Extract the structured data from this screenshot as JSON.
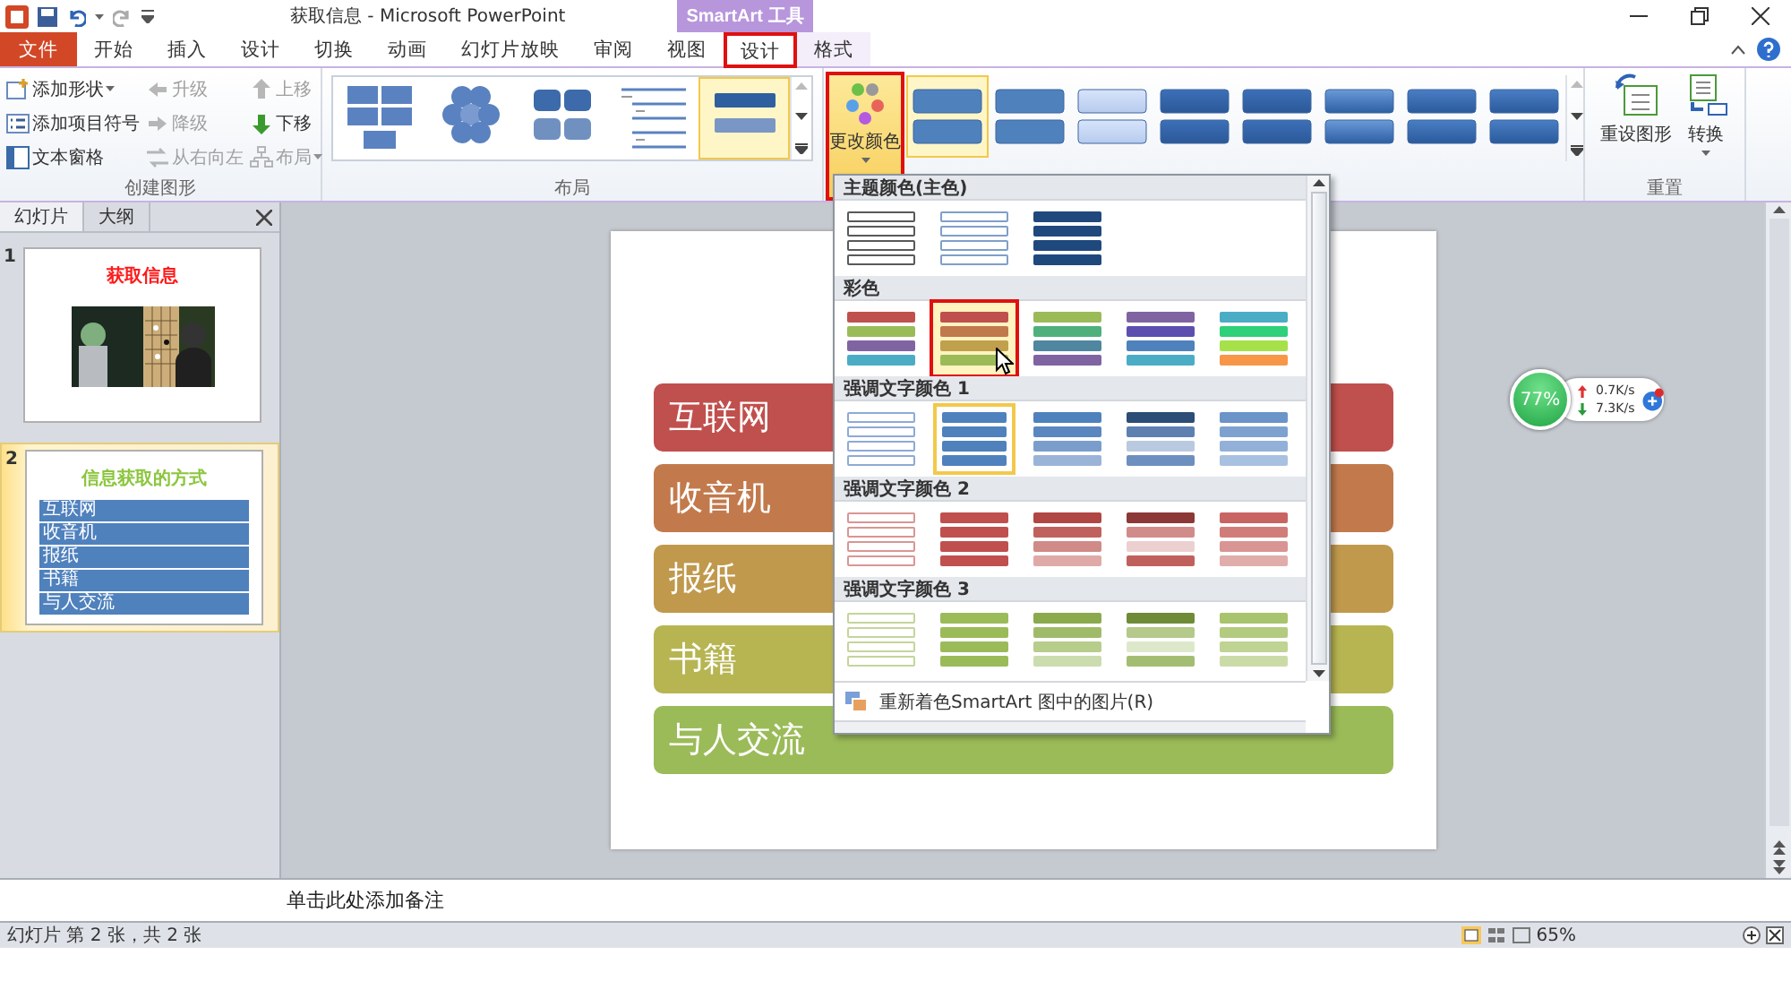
{
  "title_bar": {
    "title": "获取信息 - Microsoft PowerPoint",
    "contextual_label": "SmartArt 工具"
  },
  "tabs": [
    {
      "label": "文件",
      "kind": "file",
      "selected": false,
      "annotated": false
    },
    {
      "label": "开始",
      "kind": "normal",
      "selected": false,
      "annotated": false
    },
    {
      "label": "插入",
      "kind": "normal",
      "selected": false,
      "annotated": false
    },
    {
      "label": "设计",
      "kind": "normal",
      "selected": false,
      "annotated": false
    },
    {
      "label": "切换",
      "kind": "normal",
      "selected": false,
      "annotated": false
    },
    {
      "label": "动画",
      "kind": "normal",
      "selected": false,
      "annotated": false
    },
    {
      "label": "幻灯片放映",
      "kind": "normal",
      "selected": false,
      "annotated": false
    },
    {
      "label": "审阅",
      "kind": "normal",
      "selected": false,
      "annotated": false
    },
    {
      "label": "视图",
      "kind": "normal",
      "selected": false,
      "annotated": false
    },
    {
      "label": "设计",
      "kind": "contextual",
      "selected": true,
      "annotated": true
    },
    {
      "label": "格式",
      "kind": "contextual",
      "selected": false,
      "annotated": false
    }
  ],
  "create_group": {
    "label": "创建图形",
    "columns": [
      [
        {
          "label": "添加形状",
          "kind": "add_shape",
          "disabled": false,
          "dropdown": true
        },
        {
          "label": "添加项目符号",
          "kind": "add_bullet",
          "disabled": false,
          "dropdown": false
        },
        {
          "label": "文本窗格",
          "kind": "text_pane",
          "disabled": false,
          "dropdown": false
        }
      ],
      [
        {
          "label": "升级",
          "kind": "promote",
          "disabled": true,
          "dropdown": false
        },
        {
          "label": "降级",
          "kind": "demote",
          "disabled": true,
          "dropdown": false
        },
        {
          "label": "从右向左",
          "kind": "rtl",
          "disabled": true,
          "dropdown": false
        }
      ],
      [
        {
          "label": "上移",
          "kind": "move_up",
          "disabled": true,
          "dropdown": false
        },
        {
          "label": "下移",
          "kind": "move_down",
          "disabled": false,
          "dropdown": false
        },
        {
          "label": "布局",
          "kind": "layout",
          "disabled": true,
          "dropdown": true
        }
      ]
    ]
  },
  "layout_group": {
    "label": "布局",
    "layouts": [
      {
        "kind": "grid",
        "selected": false
      },
      {
        "kind": "hexagon",
        "selected": false
      },
      {
        "kind": "rounded",
        "selected": false
      },
      {
        "kind": "lines",
        "selected": false
      },
      {
        "kind": "bars",
        "selected": true
      }
    ]
  },
  "style_group": {
    "color_button": {
      "label": "更改颜色",
      "pressed": true,
      "annotated": true
    },
    "styles": [
      {
        "kind": "flat",
        "selected": true
      },
      {
        "kind": "flat",
        "selected": false
      },
      {
        "kind": "light",
        "selected": false
      },
      {
        "kind": "intense",
        "selected": false
      },
      {
        "kind": "intense",
        "selected": false
      },
      {
        "kind": "polished",
        "selected": false
      },
      {
        "kind": "inset",
        "selected": false
      },
      {
        "kind": "inset",
        "selected": false
      }
    ]
  },
  "reset_group": {
    "label": "重置",
    "buttons": [
      {
        "label": "重设图形",
        "kind": "reset",
        "dropdown": false
      },
      {
        "label": "转换",
        "kind": "convert",
        "dropdown": true
      }
    ]
  },
  "slides_panel": {
    "tabs": [
      {
        "label": "幻灯片",
        "selected": true
      },
      {
        "label": "大纲",
        "selected": false
      }
    ],
    "slides": [
      {
        "number": "1",
        "kind": "title_picture",
        "title": "获取信息",
        "selected": false
      },
      {
        "number": "2",
        "kind": "title_list",
        "title": "信息获取的方式",
        "selected": true,
        "items": [
          "互联网",
          "收音机",
          "报纸",
          "书籍",
          "与人交流"
        ]
      }
    ]
  },
  "slide": {
    "items": [
      {
        "text": "互联网",
        "color": "#c0504d"
      },
      {
        "text": "收音机",
        "color": "#c27a4c"
      },
      {
        "text": "报纸",
        "color": "#c0994d"
      },
      {
        "text": "书籍",
        "color": "#b7b552"
      },
      {
        "text": "与人交流",
        "color": "#9bbb59"
      }
    ]
  },
  "color_menu": {
    "sections": [
      {
        "title": "主题颜色(主色)",
        "options": [
          {
            "kind": "outline",
            "bars": [
              {
                "color": "#595959"
              },
              {
                "color": "#595959"
              },
              {
                "color": "#595959"
              },
              {
                "color": "#595959"
              }
            ],
            "selected": false,
            "hovered": false,
            "annotated": false
          },
          {
            "kind": "outline",
            "bars": [
              {
                "color": "#7f9fc9"
              },
              {
                "color": "#7f9fc9"
              },
              {
                "color": "#7f9fc9"
              },
              {
                "color": "#7f9fc9"
              }
            ],
            "selected": false,
            "hovered": false,
            "annotated": false
          },
          {
            "kind": "fill",
            "bars": [
              {
                "color": "#1f497d"
              },
              {
                "color": "#1f497d"
              },
              {
                "color": "#1f497d"
              },
              {
                "color": "#1f497d"
              }
            ],
            "selected": false,
            "hovered": false,
            "annotated": false
          }
        ]
      },
      {
        "title": "彩色",
        "options": [
          {
            "kind": "fill",
            "bars": [
              {
                "color": "#c0504d"
              },
              {
                "color": "#9bbb59"
              },
              {
                "color": "#8064a2"
              },
              {
                "color": "#4bacc6"
              }
            ],
            "selected": false,
            "hovered": false,
            "annotated": false
          },
          {
            "kind": "fill",
            "bars": [
              {
                "color": "#c0504d"
              },
              {
                "color": "#c0784d"
              },
              {
                "color": "#c0a04d"
              },
              {
                "color": "#9bbb59"
              }
            ],
            "selected": false,
            "hovered": true,
            "annotated": true
          },
          {
            "kind": "fill",
            "bars": [
              {
                "color": "#9bbb59"
              },
              {
                "color": "#4fb07c"
              },
              {
                "color": "#4f86a0"
              },
              {
                "color": "#8064a2"
              }
            ],
            "selected": false,
            "hovered": false,
            "annotated": false
          },
          {
            "kind": "fill",
            "bars": [
              {
                "color": "#8064a2"
              },
              {
                "color": "#5c4fb0"
              },
              {
                "color": "#4f81bd"
              },
              {
                "color": "#4bacc6"
              }
            ],
            "selected": false,
            "hovered": false,
            "annotated": false
          },
          {
            "kind": "fill",
            "bars": [
              {
                "color": "#4bacc6"
              },
              {
                "color": "#2fd07a"
              },
              {
                "color": "#a6e14a"
              },
              {
                "color": "#f79646"
              }
            ],
            "selected": false,
            "hovered": false,
            "annotated": false
          }
        ]
      },
      {
        "title": "强调文字颜色 1",
        "options": [
          {
            "kind": "outline",
            "bars": [
              {
                "color": "#8eaad6"
              },
              {
                "color": "#8eaad6"
              },
              {
                "color": "#8eaad6"
              },
              {
                "color": "#8eaad6"
              }
            ],
            "selected": false,
            "hovered": false,
            "annotated": false
          },
          {
            "kind": "fill",
            "bars": [
              {
                "color": "#4f81bd"
              },
              {
                "color": "#4f81bd"
              },
              {
                "color": "#4f81bd"
              },
              {
                "color": "#4f81bd"
              }
            ],
            "selected": true,
            "hovered": false,
            "annotated": false
          },
          {
            "kind": "fill",
            "bars": [
              {
                "color": "#4f81bd"
              },
              {
                "color": "#5b87c0"
              },
              {
                "color": "#7a9dcc"
              },
              {
                "color": "#9ab4d8"
              }
            ],
            "selected": false,
            "hovered": false,
            "annotated": false
          },
          {
            "kind": "fill",
            "bars": [
              {
                "color": "#2c4d75"
              },
              {
                "color": "#5e80b0"
              },
              {
                "color": "#b9c9e0"
              },
              {
                "color": "#6d8fc0"
              }
            ],
            "selected": false,
            "hovered": false,
            "annotated": false
          },
          {
            "kind": "fill",
            "bars": [
              {
                "color": "#6b94c8"
              },
              {
                "color": "#7ea2d0"
              },
              {
                "color": "#93b1d8"
              },
              {
                "color": "#a9c1e0"
              }
            ],
            "selected": false,
            "hovered": false,
            "annotated": false
          }
        ]
      },
      {
        "title": "强调文字颜色 2",
        "options": [
          {
            "kind": "outline",
            "bars": [
              {
                "color": "#d99694"
              },
              {
                "color": "#d99694"
              },
              {
                "color": "#d99694"
              },
              {
                "color": "#d99694"
              }
            ],
            "selected": false,
            "hovered": false,
            "annotated": false
          },
          {
            "kind": "fill",
            "bars": [
              {
                "color": "#c0504d"
              },
              {
                "color": "#c0504d"
              },
              {
                "color": "#c0504d"
              },
              {
                "color": "#c0504d"
              }
            ],
            "selected": false,
            "hovered": false,
            "annotated": false
          },
          {
            "kind": "fill",
            "bars": [
              {
                "color": "#b14744"
              },
              {
                "color": "#c0615e"
              },
              {
                "color": "#d08a88"
              },
              {
                "color": "#dfa9a7"
              }
            ],
            "selected": false,
            "hovered": false,
            "annotated": false
          },
          {
            "kind": "fill",
            "bars": [
              {
                "color": "#8c3836"
              },
              {
                "color": "#d18c8a"
              },
              {
                "color": "#ecd0cf"
              },
              {
                "color": "#c0605d"
              }
            ],
            "selected": false,
            "hovered": false,
            "annotated": false
          },
          {
            "kind": "fill",
            "bars": [
              {
                "color": "#c86562"
              },
              {
                "color": "#d07d7a"
              },
              {
                "color": "#d89593"
              },
              {
                "color": "#e0adab"
              }
            ],
            "selected": false,
            "hovered": false,
            "annotated": false
          }
        ]
      },
      {
        "title": "强调文字颜色 3",
        "options": [
          {
            "kind": "outline",
            "bars": [
              {
                "color": "#c3d69b"
              },
              {
                "color": "#c3d69b"
              },
              {
                "color": "#c3d69b"
              },
              {
                "color": "#c3d69b"
              }
            ],
            "selected": false,
            "hovered": false,
            "annotated": false
          },
          {
            "kind": "fill",
            "bars": [
              {
                "color": "#9bbb59"
              },
              {
                "color": "#9bbb59"
              },
              {
                "color": "#9bbb59"
              },
              {
                "color": "#9bbb59"
              }
            ],
            "selected": false,
            "hovered": false,
            "annotated": false
          },
          {
            "kind": "fill",
            "bars": [
              {
                "color": "#8aaa4d"
              },
              {
                "color": "#9fbb6a"
              },
              {
                "color": "#b6cd8c"
              },
              {
                "color": "#cbdcaf"
              }
            ],
            "selected": false,
            "hovered": false,
            "annotated": false
          },
          {
            "kind": "fill",
            "bars": [
              {
                "color": "#6f8b38"
              },
              {
                "color": "#b4c98a"
              },
              {
                "color": "#dde8ca"
              },
              {
                "color": "#a3be72"
              }
            ],
            "selected": false,
            "hovered": false,
            "annotated": false
          },
          {
            "kind": "fill",
            "bars": [
              {
                "color": "#a8c46c"
              },
              {
                "color": "#b3cb7e"
              },
              {
                "color": "#bfd393"
              },
              {
                "color": "#cbdba8"
              }
            ],
            "selected": false,
            "hovered": false,
            "annotated": false
          }
        ]
      }
    ],
    "footer": "重新着色SmartArt 图中的图片(R)"
  },
  "network_widget": {
    "percent": "77%",
    "upload": "0.7K/s",
    "download": "7.3K/s"
  },
  "notes": {
    "placeholder": "单击此处添加备注"
  },
  "status_bar": {
    "slide_info": "幻灯片 第 2 张，共 2 张",
    "zoom": "65%"
  }
}
